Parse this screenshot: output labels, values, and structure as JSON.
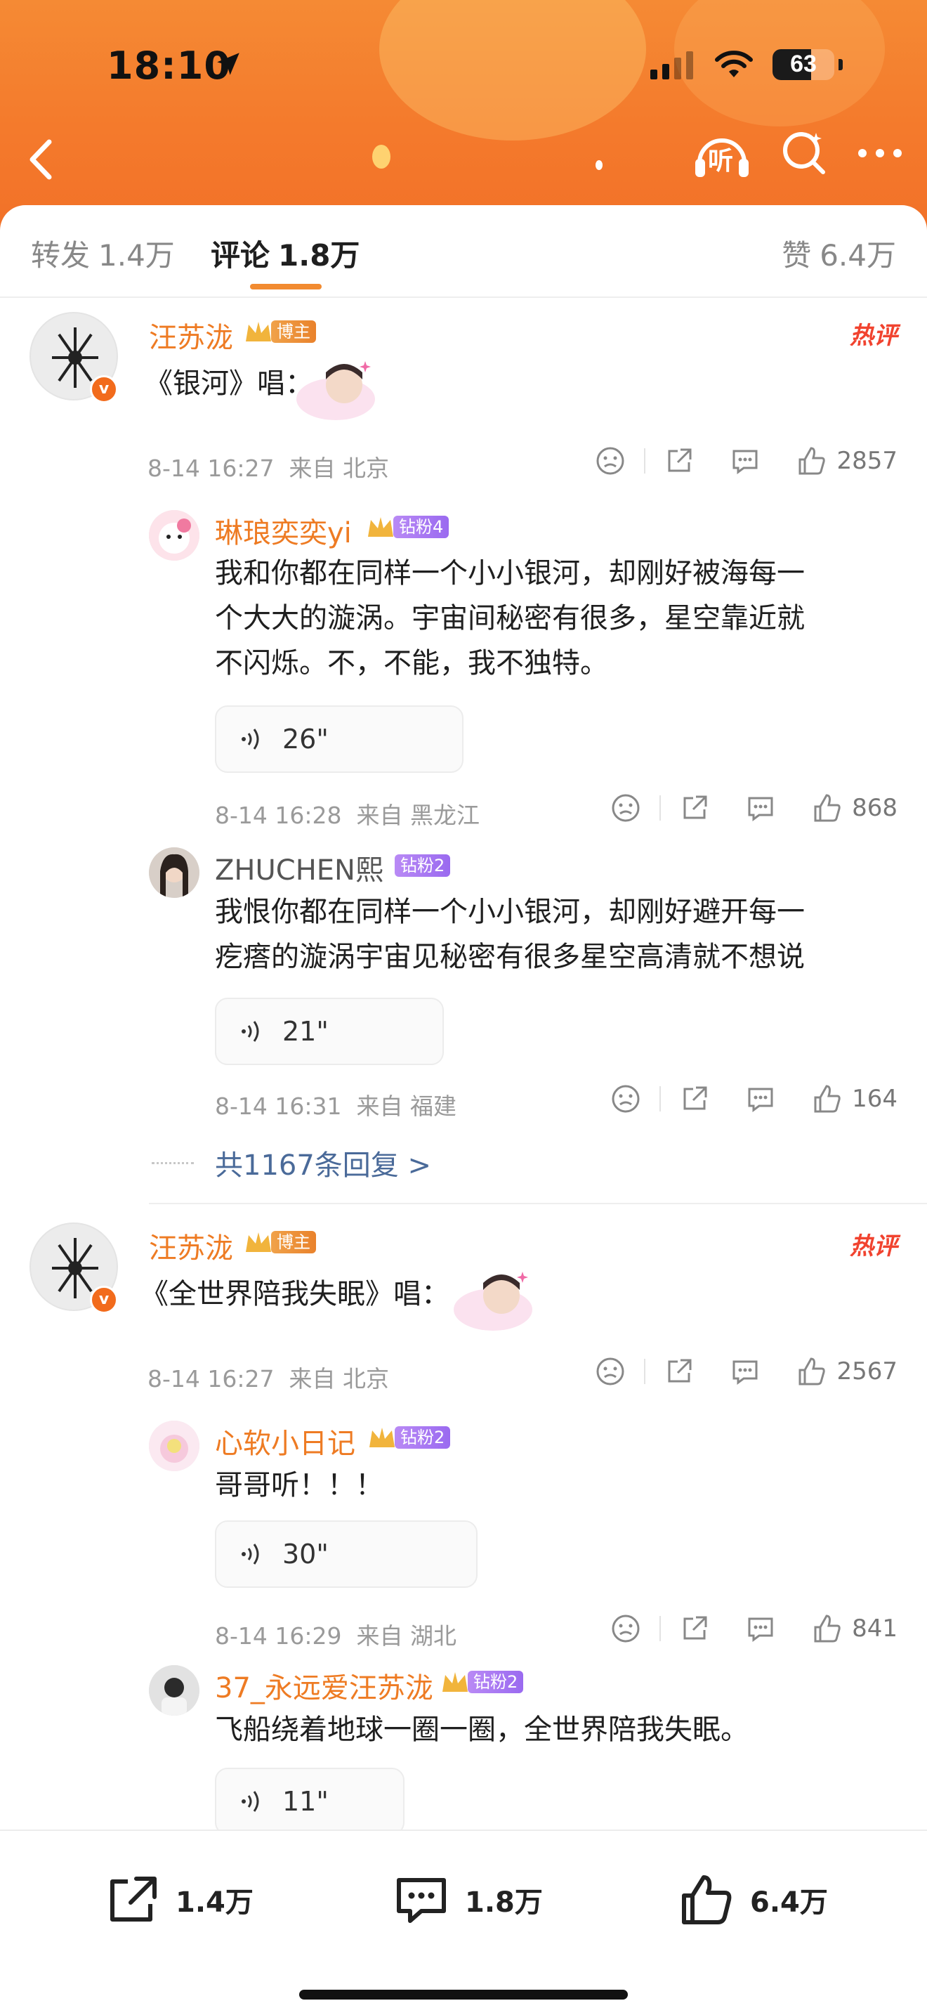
{
  "status": {
    "time": "18:10",
    "battery": "63"
  },
  "tabs": [
    {
      "label": "转发",
      "count": "1.4万"
    },
    {
      "label": "评论",
      "count": "1.8万"
    },
    {
      "label": "赞",
      "count": "6.4万"
    }
  ],
  "colors": {
    "accent": "#f47a2c",
    "username": "#ee7b23",
    "hot": "#f1432f",
    "link": "#4a6a99"
  },
  "comments": [
    {
      "user": "汪苏泷",
      "badge": "博主",
      "hot": "热评",
      "text": "《银河》唱：",
      "time": "8-14 16:27",
      "from": "来自 北京",
      "likes": "2857",
      "replies": [
        {
          "user": "琳琅奕奕yi",
          "badge": "钻粉4",
          "lines": [
            "我和你都在同样一个小小银河，却刚好被海每一",
            "个大大的漩涡。宇宙间秘密有很多，星空靠近就",
            "不闪烁。不，不能，我不独特。"
          ],
          "audio": "26\"",
          "time": "8-14 16:28",
          "from": "来自 黑龙江",
          "likes": "868"
        },
        {
          "user": "ZHUCHEN熙",
          "badge": "钻粉2",
          "lines": [
            "我恨你都在同样一个小小银河，却刚好避开每一",
            "疙瘩的漩涡宇宙见秘密有很多星空高清就不想说"
          ],
          "audio": "21\"",
          "time": "8-14 16:31",
          "from": "来自 福建",
          "likes": "164"
        }
      ],
      "more": "共1167条回复 >"
    },
    {
      "user": "汪苏泷",
      "badge": "博主",
      "hot": "热评",
      "text": "《全世界陪我失眠》唱：",
      "time": "8-14 16:27",
      "from": "来自 北京",
      "likes": "2567",
      "replies": [
        {
          "user": "心软小日记",
          "badge": "钻粉2",
          "lines": [
            "哥哥听！！！"
          ],
          "audio": "30\"",
          "time": "8-14 16:29",
          "from": "来自 湖北",
          "likes": "841"
        },
        {
          "user": "37_永远爱汪苏泷",
          "badge": "钻粉2",
          "lines": [
            "飞船绕着地球一圈一圈，全世界陪我失眠。"
          ],
          "audio": "11\""
        }
      ]
    }
  ],
  "bottom": {
    "repost": "1.4万",
    "comment": "1.8万",
    "like": "6.4万"
  },
  "header_icon": {
    "listen": "听"
  }
}
